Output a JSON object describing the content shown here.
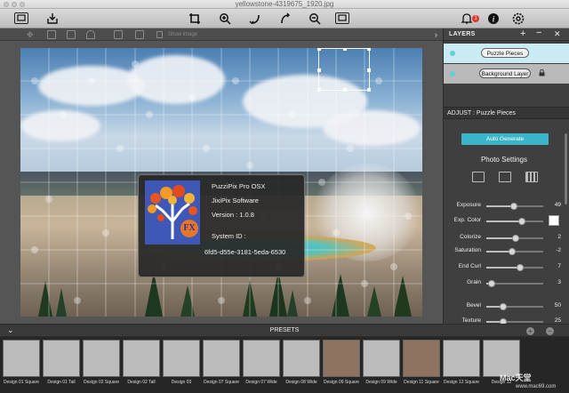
{
  "window": {
    "title": "yellowstone-4319675_1920.jpg"
  },
  "toolbar": {
    "notification_count": "1",
    "icons": [
      "open-image-icon",
      "import-icon",
      "crop-icon",
      "zoom-in-icon",
      "rotate-left-icon",
      "rotate-right-icon",
      "zoom-out-icon",
      "fit-screen-icon",
      "bell-icon",
      "info-icon",
      "settings-icon"
    ]
  },
  "subtoolbar": {
    "show_label": "Show image"
  },
  "about": {
    "product": "PuzziPix Pro OSX",
    "company": "JixiPix Software",
    "version": "Version : 1.0.8",
    "system_id_label": "System ID :",
    "system_id": "6fd5-d55e-3181-5eda-6530"
  },
  "layers": {
    "header": "LAYERS",
    "items": [
      {
        "label": "Puzzle Pieces",
        "active": true
      },
      {
        "label": "Background Layer",
        "locked": true
      }
    ]
  },
  "adjust": {
    "header": "ADJUST : Puzzle Pieces",
    "auto_generate": "Auto Generate",
    "photo_settings": "Photo Settings",
    "sliders": [
      {
        "name": "Exposure",
        "value": "49",
        "pct": 0.49
      },
      {
        "name": "Exp. Color",
        "value": "",
        "pct": 0.62,
        "color": "#ffffff"
      },
      {
        "name": "Colorize",
        "value": "2",
        "pct": 0.52
      },
      {
        "name": "Saturation",
        "value": "-2",
        "pct": 0.46
      },
      {
        "name": "End Curl",
        "value": "7",
        "pct": 0.6
      },
      {
        "name": "Grain",
        "value": "3",
        "pct": 0.1
      },
      {
        "name": "Bevel",
        "value": "50",
        "pct": 0.3
      },
      {
        "name": "Texture",
        "value": "25",
        "pct": 0.3
      }
    ]
  },
  "presets": {
    "header": "PRESETS",
    "items": [
      "Design 01 Square",
      "Design 01 Tall",
      "Design 02 Square",
      "Design 02 Tall",
      "Design 03",
      "Design 07 Square",
      "Design 07 Wide",
      "Design 08 Wide",
      "Design 09 Square",
      "Design 09 Wide",
      "Design 11 Square",
      "Design 12 Square",
      "Design 12"
    ]
  },
  "watermark": {
    "line1": "Mac天堂",
    "line2": "www.mac69.com"
  }
}
